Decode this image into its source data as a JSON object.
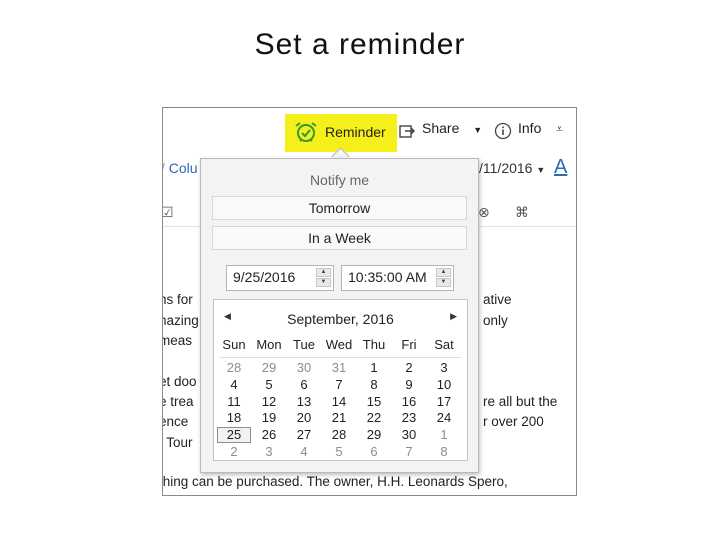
{
  "slide": {
    "title": "Set a reminder"
  },
  "ribbon": {
    "reminder_label": "Reminder",
    "share_label": "Share",
    "info_label": "Info",
    "column_fragment": "Colu",
    "date_fragment": "/11/2016",
    "font_color_label": "A"
  },
  "popup": {
    "header": "Notify me",
    "tomorrow_label": "Tomorrow",
    "in_a_week_label": "In a Week",
    "date_value": "9/25/2016",
    "time_value": "10:35:00 AM"
  },
  "calendar": {
    "month_label": "September, 2016",
    "weekdays": [
      "Sun",
      "Mon",
      "Tue",
      "Wed",
      "Thu",
      "Fri",
      "Sat"
    ],
    "weeks": [
      [
        "28",
        "29",
        "30",
        "31",
        "1",
        "2",
        "3"
      ],
      [
        "4",
        "5",
        "6",
        "7",
        "8",
        "9",
        "10"
      ],
      [
        "11",
        "12",
        "13",
        "14",
        "15",
        "16",
        "17"
      ],
      [
        "18",
        "19",
        "20",
        "21",
        "22",
        "23",
        "24"
      ],
      [
        "25",
        "26",
        "27",
        "28",
        "29",
        "30",
        "1"
      ],
      [
        "2",
        "3",
        "4",
        "5",
        "6",
        "7",
        "8"
      ]
    ],
    "outside_month": [
      [
        true,
        true,
        true,
        true,
        false,
        false,
        false
      ],
      [
        false,
        false,
        false,
        false,
        false,
        false,
        false
      ],
      [
        false,
        false,
        false,
        false,
        false,
        false,
        false
      ],
      [
        false,
        false,
        false,
        false,
        false,
        false,
        false
      ],
      [
        false,
        false,
        false,
        false,
        false,
        false,
        true
      ],
      [
        true,
        true,
        true,
        true,
        true,
        true,
        true
      ]
    ],
    "selected_day": "25"
  },
  "document": {
    "left_fragments": [
      "ns for",
      "nazing",
      "meas",
      "et doo",
      "e trea",
      "ence",
      "t Tour"
    ],
    "right_fragments": [
      "ative",
      "only",
      "re all but the",
      "r over 200"
    ],
    "bottom_line": "thing can be purchased. The owner, H.H. Leonards Spero,"
  },
  "colors": {
    "highlight": "#f5f01a",
    "reminder_icon": "#2e9a3a",
    "accent_blue": "#2b6cb0"
  }
}
